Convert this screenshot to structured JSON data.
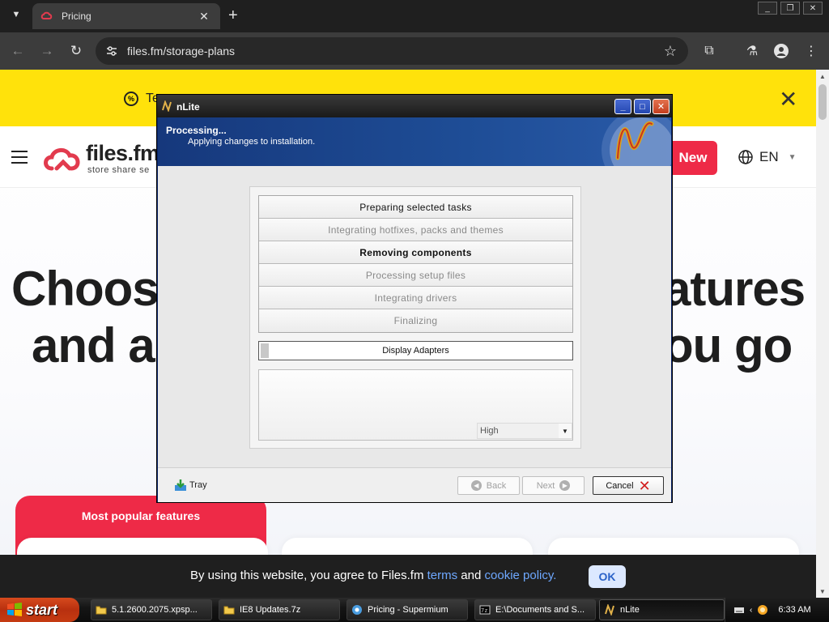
{
  "browser": {
    "tab": {
      "title": "Pricing"
    },
    "url": "files.fm/storage-plans"
  },
  "page": {
    "promo_text": "Te",
    "logo": {
      "name": "files.fm",
      "tagline": "store  share  se"
    },
    "new_button": "New",
    "language": "EN",
    "hero": {
      "line1_left": "Choos",
      "line1_right": "atures",
      "line2_left": "and a",
      "line2_right": "ou go"
    },
    "popular_label": "Most popular features",
    "cookie": {
      "text_before": "By using this website, you agree to Files.fm ",
      "terms": "terms",
      "and": " and ",
      "cookie_policy": "cookie policy.",
      "ok": "OK"
    }
  },
  "dialog": {
    "title": "nLite",
    "header_title": "Processing...",
    "header_subtitle": "Applying changes to installation.",
    "tasks": [
      {
        "label": "Preparing selected tasks",
        "state": "done"
      },
      {
        "label": "Integrating hotfixes, packs and themes",
        "state": "pending"
      },
      {
        "label": "Removing components",
        "state": "current"
      },
      {
        "label": "Processing setup files",
        "state": "pending"
      },
      {
        "label": "Integrating drivers",
        "state": "pending"
      },
      {
        "label": "Finalizing",
        "state": "pending"
      }
    ],
    "progress_label": "Display Adapters",
    "priority": "High",
    "tray": "Tray",
    "back": "Back",
    "next": "Next",
    "cancel": "Cancel"
  },
  "taskbar": {
    "start": "start",
    "items": [
      {
        "label": "5.1.2600.2075.xpsp...",
        "icon": "folder-icon"
      },
      {
        "label": "IE8 Updates.7z",
        "icon": "folder-icon"
      },
      {
        "label": "Pricing - Supermium",
        "icon": "browser-icon"
      },
      {
        "label": "E:\\Documents and S...",
        "icon": "console-icon"
      },
      {
        "label": "nLite",
        "icon": "nlite-icon"
      }
    ],
    "clock": "6:33 AM"
  },
  "colors": {
    "promo": "#ffe20b",
    "brand_red": "#ee2a47",
    "dialog_header": "#1e4d96",
    "taskbar": "#151515"
  }
}
